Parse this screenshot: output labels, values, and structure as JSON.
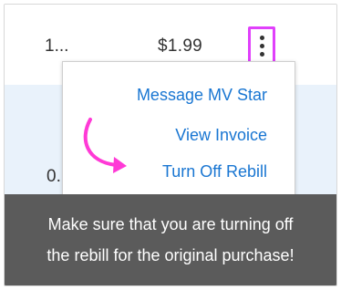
{
  "row_top": {
    "truncated_cell": "1...",
    "price": "$1.99"
  },
  "row_second": {
    "truncated_cell": "0."
  },
  "kebab_button": {
    "icon": "more-vertical-icon",
    "highlight_color": "#e040fb"
  },
  "menu": {
    "items": [
      {
        "label": "Message MV Star"
      },
      {
        "label": "View Invoice"
      },
      {
        "label": "Turn Off Rebill"
      }
    ],
    "link_color": "#1976d2"
  },
  "annotation": {
    "arrow_icon": "curved-arrow-icon",
    "arrow_color": "#ff3ad6"
  },
  "caption": {
    "line1": "Make sure that you are turning off",
    "line2": "the rebill for the original purchase!"
  }
}
